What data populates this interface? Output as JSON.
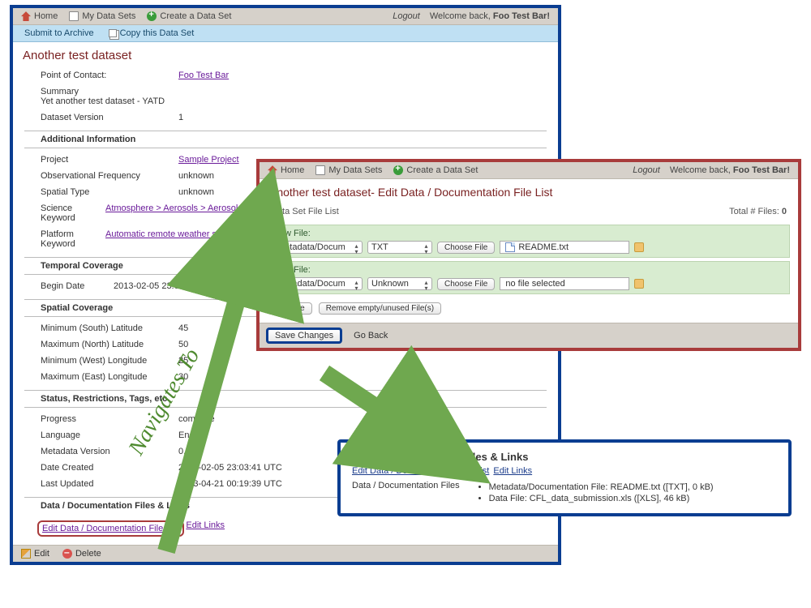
{
  "nav": {
    "home": "Home",
    "mydata": "My Data Sets",
    "create": "Create a Data Set",
    "logout": "Logout",
    "welcome_pre": "Welcome back, ",
    "welcome_user": "Foo Test Bar!",
    "submit": "Submit to Archive",
    "copy": "Copy this Data Set"
  },
  "ds": {
    "title": "Another test dataset",
    "poc_label": "Point of Contact:",
    "poc_value": "Foo Test Bar",
    "summary_label": "Summary",
    "summary_value": "Yet another test dataset - YATD",
    "version_label": "Dataset Version",
    "version_value": "1",
    "addl_head": "Additional Information",
    "project_label": "Project",
    "project_value": "Sample Project",
    "obsfreq_label": "Observational Frequency",
    "obsfreq_value": "unknown",
    "spatialtype_label": "Spatial Type",
    "spatialtype_value": "unknown",
    "scikw_label": "Science Keyword",
    "scikw_value": "Atmosphere > Aerosols > Aerosol Particle Properties",
    "platkw_label": "Platform Keyword",
    "platkw_value": "Automatic remote weather station",
    "temporal_head": "Temporal Coverage",
    "begin_label": "Begin Date",
    "begin_value": "2013-02-05 23:02:00 UTC",
    "spatial_head": "Spatial Coverage",
    "minlat_label": "Minimum (South) Latitude",
    "minlat_value": "45",
    "maxlat_label": "Maximum (North) Latitude",
    "maxlat_value": "50",
    "minlon_label": "Minimum (West) Longitude",
    "minlon_value": "25",
    "maxlon_label": "Maximum (East) Longitude",
    "maxlon_value": "30",
    "status_head": "Status, Restrictions, Tags, etc.",
    "progress_label": "Progress",
    "progress_value": "complete",
    "lang_label": "Language",
    "lang_value": "English",
    "mver_label": "Metadata Version",
    "mver_value": "0.3.5",
    "created_label": "Date Created",
    "created_value": "2013-02-05 23:03:41 UTC",
    "updated_label": "Last Updated",
    "updated_value": "2013-04-21 00:19:39 UTC",
    "dfl_head": "Data / Documentation Files & Links",
    "edit_filelist": "Edit Data / Documentation File List",
    "edit_links": "Edit Links",
    "footer_edit": "Edit",
    "footer_delete": "Delete"
  },
  "edit": {
    "title": "Another test dataset- Edit Data / Documentation File List",
    "list_head": "Data Set File List",
    "total_label": "Total # Files: ",
    "total_count": "0",
    "new_file": "New File:",
    "cat1": "Metadata/Docum",
    "type1": "TXT",
    "choose": "Choose File",
    "file1": "README.txt",
    "cat2": "Metadata/Docum",
    "type2": "Unknown",
    "file2": "no file selected",
    "add_file": "Add File",
    "remove_unused": "Remove empty/unused File(s)",
    "save": "Save Changes",
    "goback": "Go Back"
  },
  "result": {
    "head": "Data / Documentation Files & Links",
    "link1": "Edit Data / Documentation File List",
    "link2": "Edit Links",
    "files_label": "Data / Documentation Files",
    "item1": "Metadata/Documentation File: README.txt ([TXT], 0 kB)",
    "item2": "Data File: CFL_data_submission.xls ([XLS], 46 kB)"
  },
  "anno": {
    "navigates": "Navigates To"
  }
}
